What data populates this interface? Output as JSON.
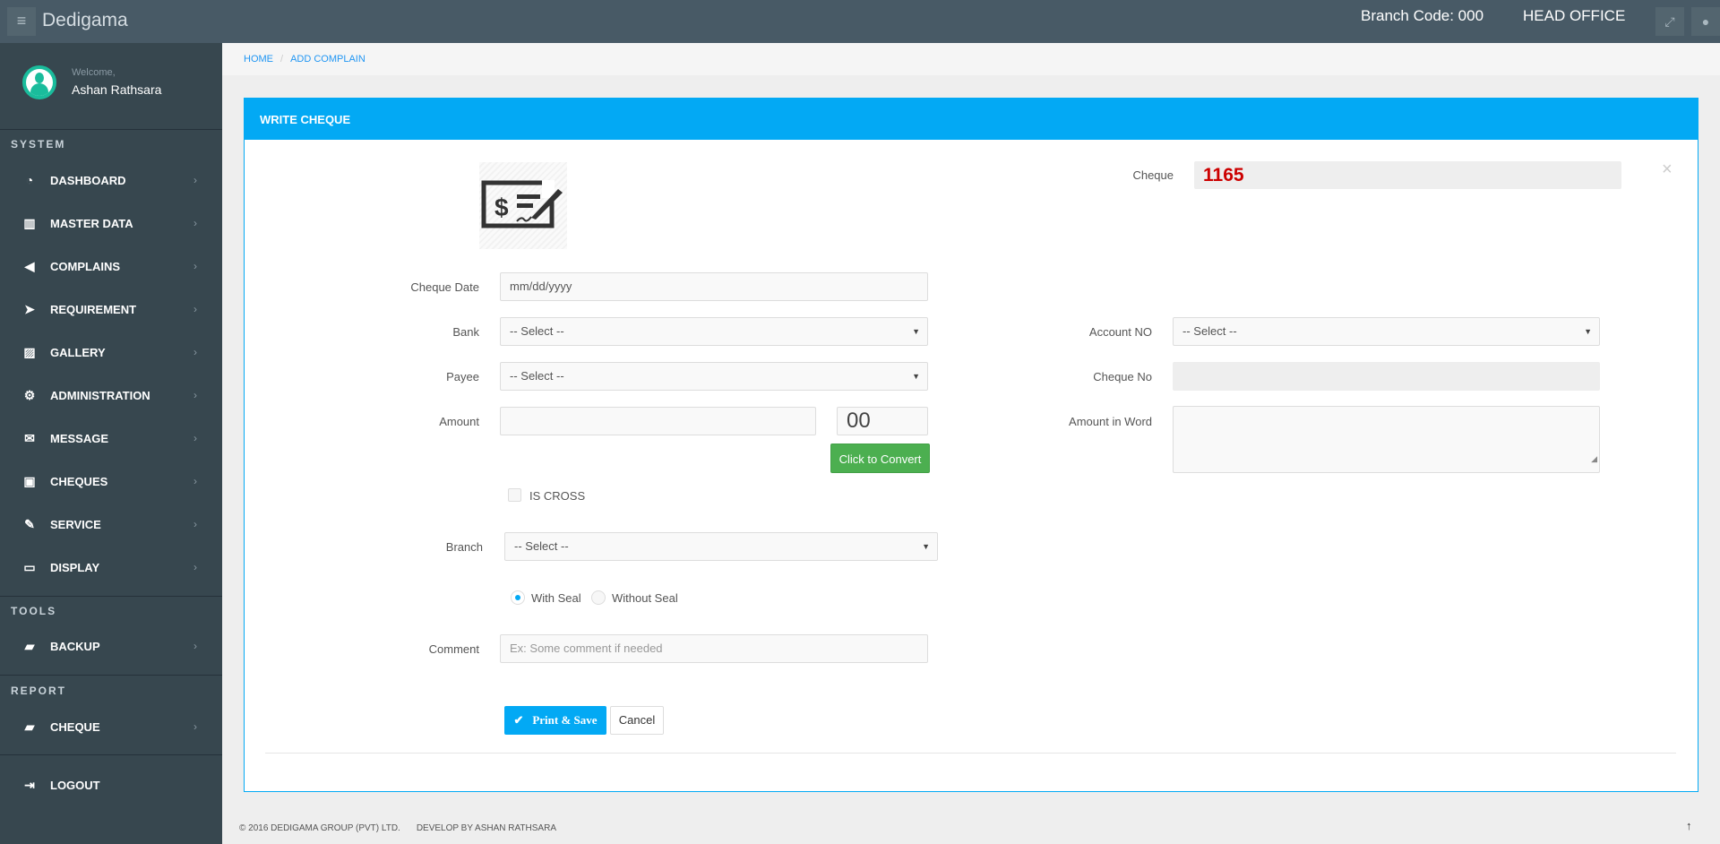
{
  "topbar": {
    "brand": "Dedigama",
    "branch_code": "Branch Code: 000",
    "office": "HEAD OFFICE"
  },
  "user": {
    "welcome": "Welcome,",
    "name": "Ashan Rathsara"
  },
  "sidebar": {
    "system_heading": "SYSTEM",
    "items": [
      {
        "label": "DASHBOARD",
        "icon": "dashboard-icon"
      },
      {
        "label": "MASTER DATA",
        "icon": "columns-icon"
      },
      {
        "label": "COMPLAINS",
        "icon": "bullhorn-icon"
      },
      {
        "label": "REQUIREMENT",
        "icon": "paper-plane-icon"
      },
      {
        "label": "GALLERY",
        "icon": "image-icon"
      },
      {
        "label": "ADMINISTRATION",
        "icon": "cogs-icon"
      },
      {
        "label": "MESSAGE",
        "icon": "envelope-icon"
      },
      {
        "label": "CHEQUES",
        "icon": "money-icon"
      },
      {
        "label": "SERVICE",
        "icon": "wrench-icon"
      },
      {
        "label": "DISPLAY",
        "icon": "desktop-icon"
      }
    ],
    "tools_heading": "TOOLS",
    "backup": "BACKUP",
    "report_heading": "REPORT",
    "cheque": "CHEQUE",
    "logout": "LOGOUT"
  },
  "breadcrumb": {
    "home": "HOME",
    "current": "ADD COMPLAIN"
  },
  "card": {
    "title": "WRITE CHEQUE"
  },
  "form": {
    "cheque_label": "Cheque",
    "cheque_value": "1165",
    "date_label": "Cheque Date",
    "date_placeholder": "mm/dd/yyyy",
    "bank_label": "Bank",
    "bank_value": "-- Select --",
    "payee_label": "Payee",
    "payee_value": "-- Select --",
    "amount_label": "Amount",
    "cents_value": "00",
    "convert_btn": "Click to Convert",
    "account_label": "Account NO",
    "account_value": "-- Select --",
    "cheque_no_label": "Cheque No",
    "amount_word_label": "Amount in Word",
    "is_cross": "IS CROSS",
    "branch_label": "Branch",
    "branch_value": "-- Select --",
    "with_seal": "With Seal",
    "without_seal": "Without Seal",
    "comment_label": "Comment",
    "comment_placeholder": "Ex: Some comment if needed",
    "print_save": "Print & Save",
    "cancel": "Cancel"
  },
  "footer": {
    "copyright": "© 2016 DEDIGAMA GROUP (PVT) LTD.",
    "developer": "DEVELOP BY ASHAN RATHSARA"
  },
  "colors": {
    "accent": "#03a9f4",
    "success": "#4caf50",
    "sidebar": "#37474f",
    "cheque_number": "#cc0000"
  }
}
